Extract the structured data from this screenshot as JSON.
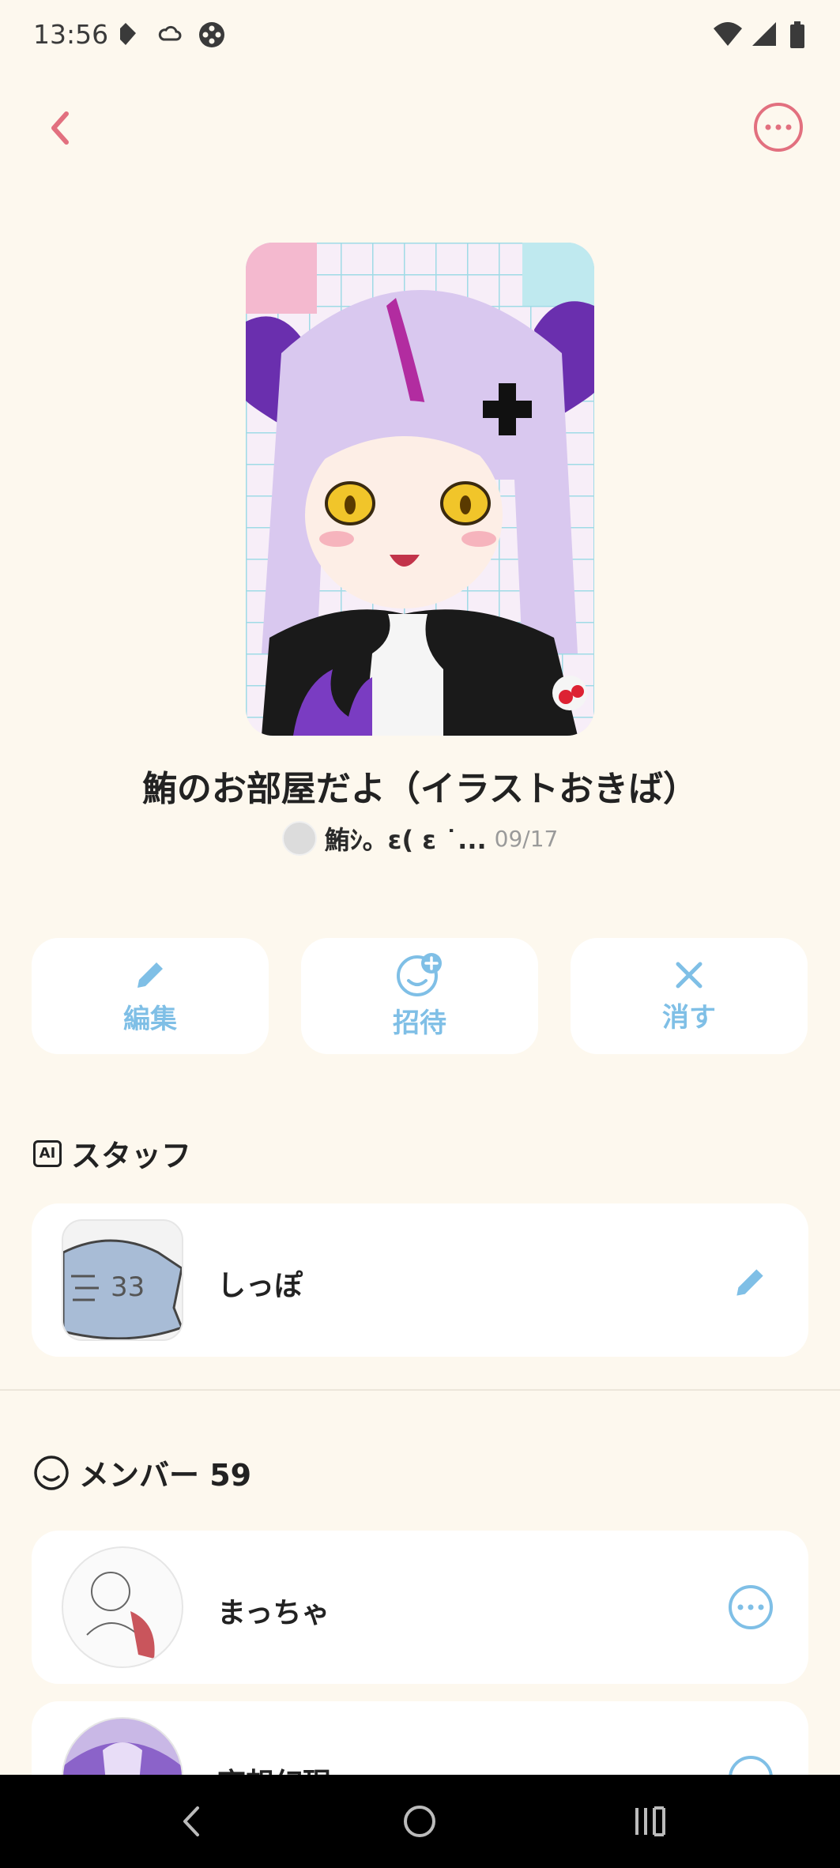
{
  "status_bar": {
    "time": "13:56"
  },
  "header": {
    "back_icon": "chevron-left-icon",
    "more_icon": "more-horizontal-icon"
  },
  "room": {
    "title": "鮪のお部屋だよ（イラストおきば）",
    "owner_name": "鮪ｼ。ε( ε ˙...",
    "date": "09/17"
  },
  "actions": [
    {
      "label": "編集",
      "icon": "pencil-icon"
    },
    {
      "label": "招待",
      "icon": "invite-face-icon"
    },
    {
      "label": "消す",
      "icon": "close-icon"
    }
  ],
  "staff": {
    "heading": "スタッフ",
    "ai_badge": "AI",
    "items": [
      {
        "name": "しっぽ"
      }
    ]
  },
  "members": {
    "heading": "メンバー 59",
    "items": [
      {
        "name": "まっちゃ"
      },
      {
        "name": "夜想幻現"
      }
    ]
  },
  "colors": {
    "background": "#fdf8ee",
    "accent_pink": "#e2707f",
    "accent_blue": "#7fbfe6"
  }
}
